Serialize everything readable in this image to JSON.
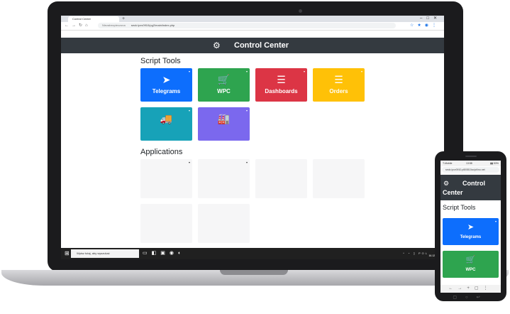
{
  "browser": {
    "tab_title": "Control Center",
    "new_tab": "+",
    "window_controls": "–□✕",
    "nav": "←→↻⌂",
    "security_label": "Niezabezpieczona",
    "url": "seck:/pxv0910/pg2/main/index.php",
    "toolbar_icons": "☆★◉⋮"
  },
  "app": {
    "title": "Control Center",
    "script_tools_heading": "Script Tools",
    "applications_heading": "Applications",
    "tiles": [
      {
        "label": "Telegrams",
        "icon": "paper-plane-icon",
        "glyph": "➤",
        "color": "#0d6efd",
        "caret": "▾"
      },
      {
        "label": "WPC",
        "icon": "shopping-cart-icon",
        "glyph": "🛒",
        "color": "#2ea44f",
        "caret": "▾"
      },
      {
        "label": "Dashboards",
        "icon": "list-icon",
        "glyph": "☰",
        "color": "#dc3545",
        "caret": "▾"
      },
      {
        "label": "Orders",
        "icon": "list-icon",
        "glyph": "☰",
        "color": "#ffc107",
        "caret": "▾"
      },
      {
        "label": "",
        "icon": "truck-icon",
        "glyph": "🚚",
        "color": "#17a2b8",
        "caret": "▾"
      },
      {
        "label": "",
        "icon": "factory-icon",
        "glyph": "🏭",
        "color": "#7b68ee",
        "caret": "▾"
      }
    ],
    "app_tile_carets": [
      "▾",
      "▾",
      "",
      "",
      "",
      ""
    ]
  },
  "taskbar": {
    "start_glyph": "⊞",
    "search_placeholder": "Wpisz tutaj, aby wyszukać",
    "icons": "▭◧▣◉◐",
    "tray": "^ ◔ ▯ POL",
    "time": "13:57",
    "date": "16.12.2021"
  },
  "phone": {
    "status_left": "T-Mobile",
    "status_center": "13:58",
    "status_right": "▮▮ 53%",
    "url": "seck:/pxv0910.pl8/0810cc/pt/ino.net",
    "title": "Control Center",
    "script_tools_heading": "Script Tools",
    "tiles": [
      {
        "label": "Telegrams",
        "icon": "paper-plane-icon",
        "glyph": "➤",
        "color": "#0d6efd",
        "caret": "▾"
      },
      {
        "label": "WPC",
        "icon": "shopping-cart-icon",
        "glyph": "🛒",
        "color": "#2ea44f",
        "caret": ""
      }
    ],
    "nav": "←→+▢⋮",
    "home_buttons": "▢○↩"
  },
  "colors": {
    "header_bg": "#343a40",
    "taskbar_bg": "#202020",
    "device_frame": "#1b1b1d"
  }
}
